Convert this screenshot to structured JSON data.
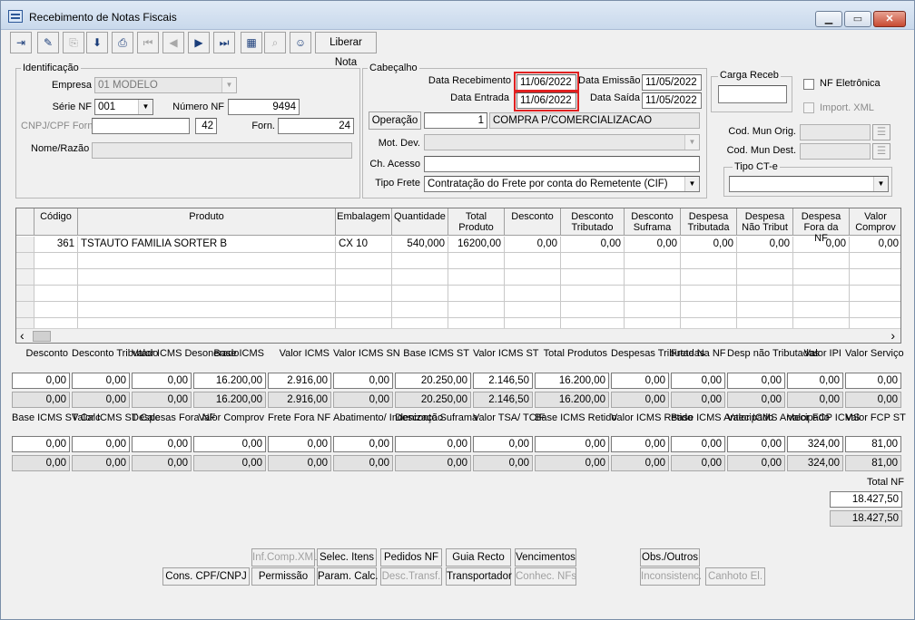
{
  "window": {
    "title": "Recebimento de Notas Fiscais",
    "min": "▁",
    "max": "▭",
    "close": "✕"
  },
  "toolbar": {
    "icons": [
      "exit-icon",
      "eraser-icon",
      "copy-icon",
      "save-icon",
      "print-icon",
      "first-record-icon",
      "previous-record-icon",
      "next-record-icon",
      "last-record-icon",
      "spreadsheet-icon",
      "binoculars-icon",
      "user-search-icon"
    ],
    "glyphs": [
      "⇥",
      "✎",
      "⎘",
      "⬇",
      "⎙",
      "⏮",
      "◀",
      "▶",
      "⏭",
      "▦",
      "⌕",
      "☺"
    ],
    "liberar_nota": "Liberar Nota"
  },
  "identificacao": {
    "title": "Identificação",
    "empresa_label": "Empresa",
    "empresa_value": "01 MODELO",
    "serie_label": "Série NF",
    "serie_value": "001",
    "numero_label": "Número NF",
    "numero_value": "9494",
    "cnpj_label": "CNPJ/CPF Forn.",
    "cnpj_value": "",
    "cnpj_num": "42",
    "forn_label": "Forn.",
    "forn_value": "24",
    "nome_label": "Nome/Razão",
    "nome_value": ""
  },
  "cabecalho": {
    "title": "Cabeçalho",
    "data_receb_label": "Data Recebimento",
    "data_receb": "11/06/2022",
    "data_entrada_label": "Data Entrada",
    "data_entrada": "11/06/2022",
    "data_emissao_label": "Data Emissão",
    "data_emissao": "11/05/2022",
    "data_saida_label": "Data Saída",
    "data_saida": "11/05/2022",
    "operacao_label": "Operação",
    "operacao_num": "1",
    "operacao_desc": "COMPRA P/COMERCIALIZACAO",
    "mot_dev_label": "Mot. Dev.",
    "mot_dev_value": "",
    "ch_acesso_label": "Ch. Acesso",
    "ch_acesso_value": "",
    "tipo_frete_label": "Tipo Frete",
    "tipo_frete_value": "Contratação do Frete por conta do Remetente (CIF)"
  },
  "right_panel": {
    "carga_receb_label": "Carga Receb",
    "carga_receb_value": "",
    "nf_eletronica_label": "NF Eletrônica",
    "import_xml_label": "Import. XML",
    "cod_mun_orig_label": "Cod. Mun Orig.",
    "cod_mun_dest_label": "Cod. Mun Dest.",
    "tipo_cte_label": "Tipo CT-e",
    "tipo_cte_value": ""
  },
  "grid": {
    "headers": [
      "Código",
      "Produto",
      "Embalagem",
      "Quantidade",
      "Total Produto",
      "Desconto",
      "Desconto Tributado",
      "Desconto Suframa",
      "Despesa Tributada",
      "Despesa Não Tribut",
      "Despesa Fora da NF",
      "Valor Comprov"
    ],
    "rows": [
      [
        "361",
        "TSTAUTO FAMILIA SORTER B",
        "CX 10",
        "540,000",
        "16200,00",
        "0,00",
        "0,00",
        "0,00",
        "0,00",
        "0,00",
        "0,00",
        "0,00"
      ]
    ],
    "scroll_left": "‹",
    "scroll_right": "›"
  },
  "totals1": {
    "labels": [
      "Desconto",
      "Desconto Tributado",
      "Valor ICMS Desonerado",
      "Base ICMS",
      "Valor ICMS",
      "Valor ICMS SN",
      "Base ICMS ST",
      "Valor ICMS ST",
      "Total Produtos",
      "Despesas Tributadas",
      "Frete Na NF",
      "Desp não Tributadas",
      "Valor IPI",
      "Valor Serviço"
    ],
    "row1": [
      "0,00",
      "0,00",
      "0,00",
      "16.200,00",
      "2.916,00",
      "0,00",
      "20.250,00",
      "2.146,50",
      "16.200,00",
      "0,00",
      "0,00",
      "0,00",
      "0,00",
      "0,00"
    ],
    "row2": [
      "0,00",
      "0,00",
      "0,00",
      "16.200,00",
      "2.916,00",
      "0,00",
      "20.250,00",
      "2.146,50",
      "16.200,00",
      "0,00",
      "0,00",
      "0,00",
      "0,00",
      "0,00"
    ]
  },
  "totals2": {
    "labels": [
      "Base ICMS ST Calc",
      "Valor ICMS ST Calc",
      "Despesas Fora NF",
      "Valor Comprov",
      "Frete Fora NF",
      "Abatimento/ Indenização",
      "Desconto Suframa",
      "Valor TSA/ TCIF",
      "Base ICMS Retido",
      "Valor ICMS Retido",
      "Base ICMS Antecipado",
      "Valor ICMS Antecipado",
      "Valor FCP ICMS",
      "Valor FCP ST"
    ],
    "row1": [
      "0,00",
      "0,00",
      "0,00",
      "0,00",
      "0,00",
      "0,00",
      "0,00",
      "0,00",
      "0,00",
      "0,00",
      "0,00",
      "0,00",
      "324,00",
      "81,00"
    ],
    "row2": [
      "0,00",
      "0,00",
      "0,00",
      "0,00",
      "0,00",
      "0,00",
      "0,00",
      "0,00",
      "0,00",
      "0,00",
      "0,00",
      "0,00",
      "324,00",
      "81,00"
    ]
  },
  "total_nf": {
    "label": "Total NF",
    "value1": "18.427,50",
    "value2": "18.427,50"
  },
  "buttons": {
    "inf_comp_xml": "Inf.Comp.XML",
    "selec_itens": "Selec. Itens",
    "pedidos_nf": "Pedidos NF",
    "guia_recto": "Guia Recto",
    "vencimentos": "Vencimentos",
    "obs_outros": "Obs./Outros",
    "cons_cpf": "Cons. CPF/CNPJ",
    "permissao": "Permissão",
    "param_calc": "Param. Calc.",
    "desc_transf": "Desc.Transf.",
    "transportador": "Transportador",
    "conhec_nfs": "Conhec. NFs",
    "inconsistenc": "Inconsistenc.",
    "canhoto_el": "Canhoto El."
  },
  "colors": {
    "highlight": "#e02020",
    "titlebar": "#c9d9ec"
  }
}
